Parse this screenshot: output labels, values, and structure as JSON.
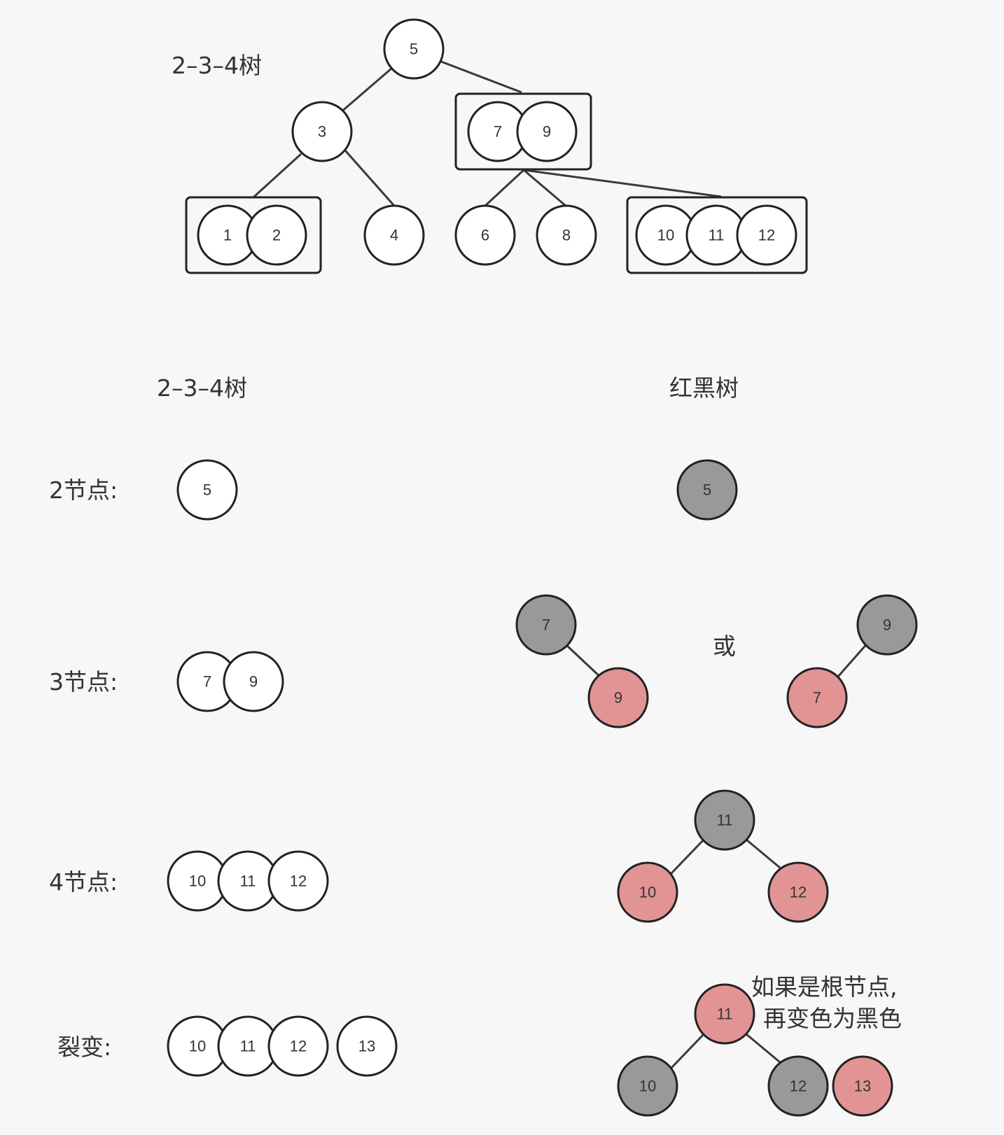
{
  "colors": {
    "background": "#f7f7f7",
    "stroke": "#222222",
    "line": "#3a3a3a",
    "white_node": "#ffffff",
    "black_node": "#999999",
    "red_node": "#e29494",
    "text": "#333333"
  },
  "labels": {
    "top_title": "2–3–4树",
    "col_234": "2–3–4树",
    "col_rb": "红黑树",
    "row_2node": "2节点:",
    "row_3node": "3节点:",
    "row_4node": "4节点:",
    "row_split": "裂变:",
    "or": "或",
    "note_line1": "如果是根节点,",
    "note_line2": "再变色为黑色"
  },
  "top_tree": {
    "root": "5",
    "left": "3",
    "right_group": [
      "7",
      "9"
    ],
    "left_children": [
      [
        "1",
        "2"
      ],
      [
        "4"
      ]
    ],
    "right_children": [
      [
        "6"
      ],
      [
        "8"
      ],
      [
        "10",
        "11",
        "12"
      ]
    ]
  },
  "rows": {
    "two_node": {
      "tree234": [
        "5"
      ],
      "rb": {
        "root": "5",
        "root_color": "black"
      }
    },
    "three_node": {
      "tree234": [
        "7",
        "9"
      ],
      "rb_option_a": {
        "parent": "7",
        "parent_color": "black",
        "child": "9",
        "child_color": "red"
      },
      "rb_option_b": {
        "parent": "9",
        "parent_color": "black",
        "child": "7",
        "child_color": "red"
      }
    },
    "four_node": {
      "tree234": [
        "10",
        "11",
        "12"
      ],
      "rb": {
        "root": "11",
        "root_color": "black",
        "left": "10",
        "left_color": "red",
        "right": "12",
        "right_color": "red"
      }
    },
    "split": {
      "tree234": [
        "10",
        "11",
        "12",
        "13"
      ],
      "rb": {
        "root": "11",
        "root_color": "red",
        "left": "10",
        "left_color": "black",
        "right": "12",
        "right_color": "black",
        "extra": "13",
        "extra_color": "red"
      }
    }
  }
}
